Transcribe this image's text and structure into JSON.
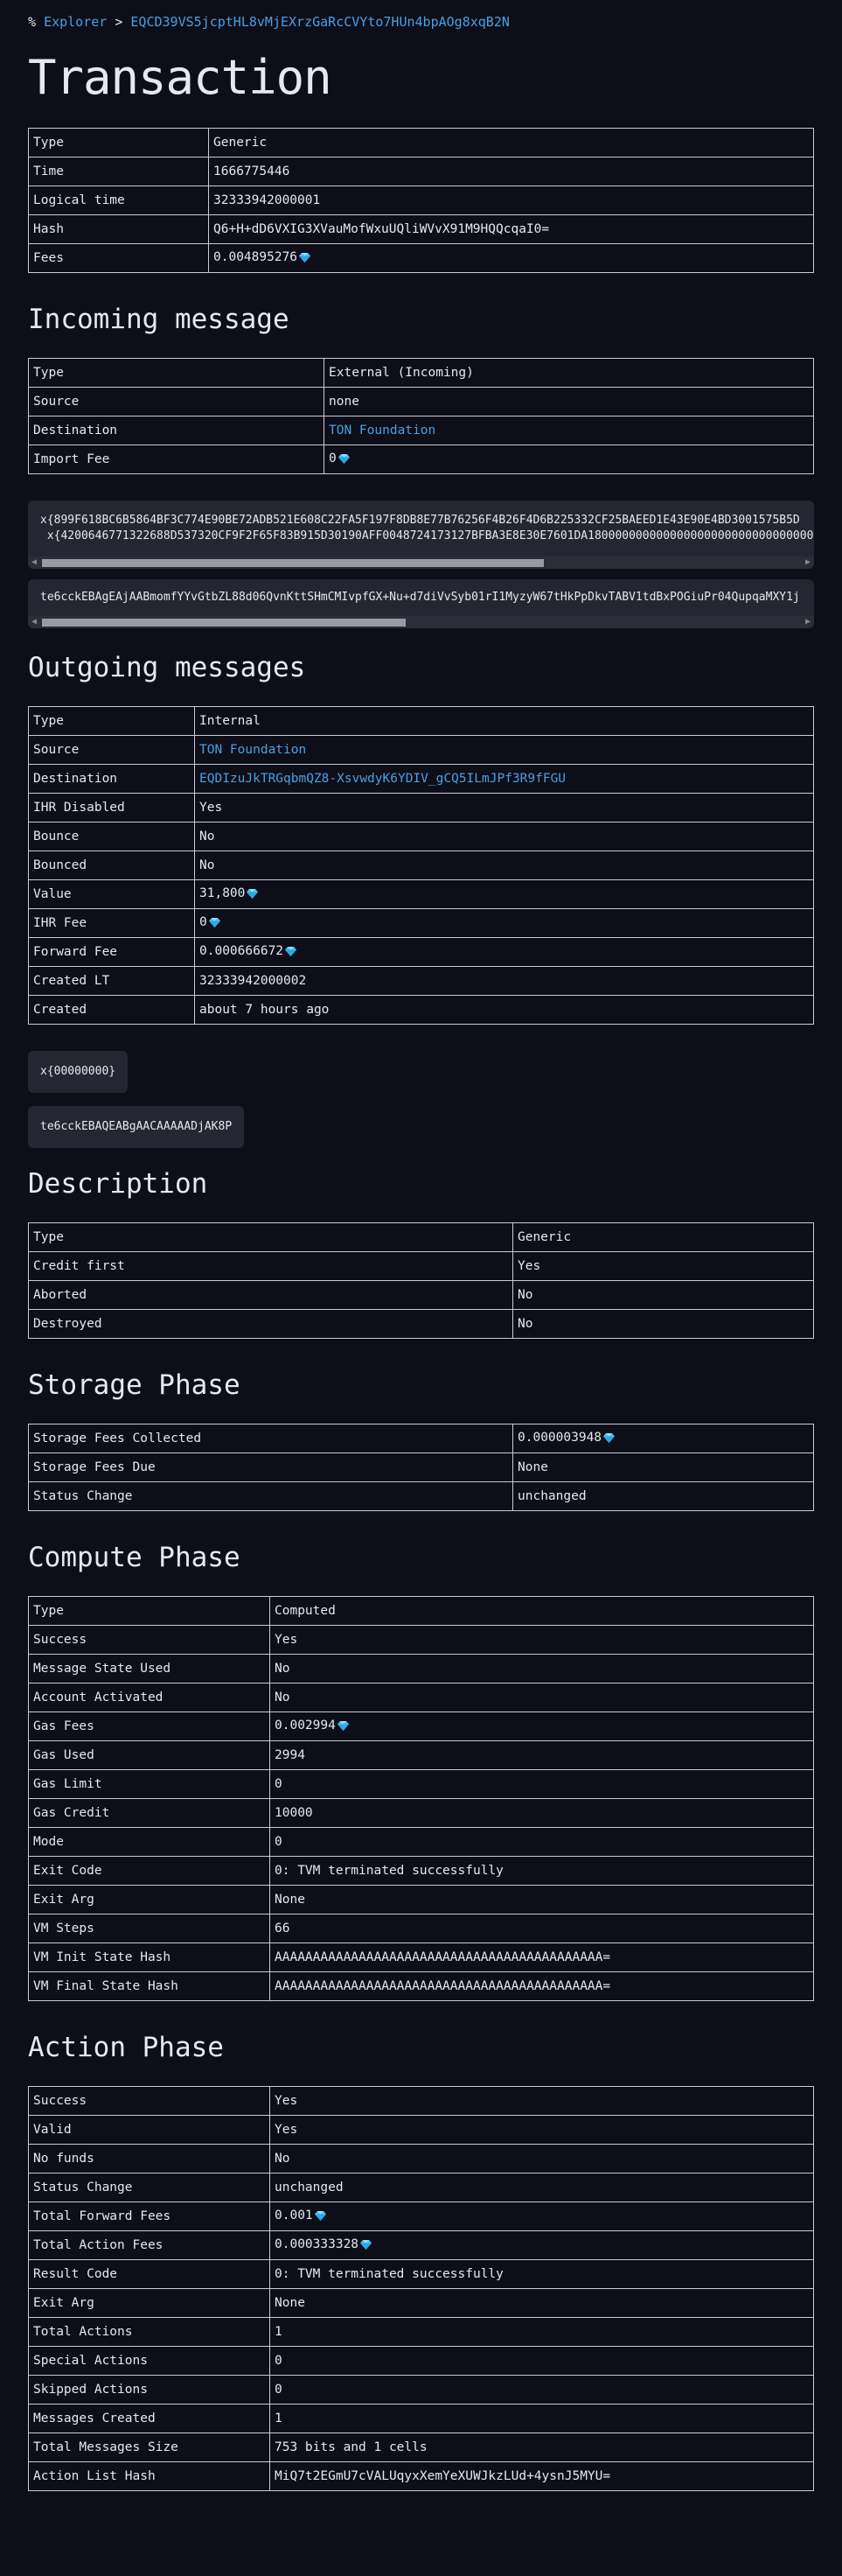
{
  "breadcrumb": {
    "icon": "%",
    "explorer": "Explorer",
    "sep": ">",
    "address": "EQCD39VS5jcptHL8vMjEXrzGaRcCVYto7HUn4bpAOg8xqB2N"
  },
  "title": "Transaction",
  "summary": [
    {
      "k": "Type",
      "v": "Generic"
    },
    {
      "k": "Time",
      "v": "1666775446"
    },
    {
      "k": "Logical time",
      "v": "32333942000001"
    },
    {
      "k": "Hash",
      "v": "Q6+H+dD6VXIG3XVauMofWxuUQliWVvX91M9HQQcqaI0="
    },
    {
      "k": "Fees",
      "v": "0.004895276",
      "gem": true
    }
  ],
  "incoming": {
    "heading": "Incoming message",
    "rows": [
      {
        "k": "Type",
        "v": "External (Incoming)"
      },
      {
        "k": "Source",
        "v": "none"
      },
      {
        "k": "Destination",
        "v": "TON Foundation",
        "link": true
      },
      {
        "k": "Import Fee",
        "v": "0",
        "gem": true
      }
    ],
    "body_line1": "x{899F618BC6B5864BF3C774E90BE72ADB521E608C22FA5F197F8DB8E77B76256F4B26F4D6B225332CF25BAEED1E43E90E4BD3001575B5D",
    "body_line2": " x{4200646771322688D537320CF9F2F65F83B915D30190AFF0048724173127BFBA3E8E30E7601DA180000000000000000000000000000000",
    "boc": "te6cckEBAgEAjAABmomfYYvGtbZL88d06QvnKttSHmCMIvpfGX+Nu+d7diVvSyb01rI1MyzyW67tHkPpDkvTABV1tdBxPOGiuPr04QupqaMXY1j"
  },
  "outgoing": {
    "heading": "Outgoing messages",
    "rows": [
      {
        "k": "Type",
        "v": "Internal"
      },
      {
        "k": "Source",
        "v": "TON Foundation",
        "link": true
      },
      {
        "k": "Destination",
        "v": "EQDIzuJkTRGqbmQZ8-XsvwdyK6YDIV_gCQ5ILmJPf3R9fFGU",
        "link": true
      },
      {
        "k": "IHR Disabled",
        "v": "Yes"
      },
      {
        "k": "Bounce",
        "v": "No"
      },
      {
        "k": "Bounced",
        "v": "No"
      },
      {
        "k": "Value",
        "v": "31,800",
        "gem": true
      },
      {
        "k": "IHR Fee",
        "v": "0",
        "gem": true
      },
      {
        "k": "Forward Fee",
        "v": "0.000666672",
        "gem": true
      },
      {
        "k": "Created LT",
        "v": "32333942000002"
      },
      {
        "k": "Created",
        "v": "about 7 hours ago"
      }
    ],
    "body": "x{00000000}",
    "boc": "te6cckEBAQEABgAACAAAAADjAK8P"
  },
  "description": {
    "heading": "Description",
    "rows": [
      {
        "k": "Type",
        "v": "Generic"
      },
      {
        "k": "Credit first",
        "v": "Yes"
      },
      {
        "k": "Aborted",
        "v": "No"
      },
      {
        "k": "Destroyed",
        "v": "No"
      }
    ]
  },
  "storage": {
    "heading": "Storage Phase",
    "rows": [
      {
        "k": "Storage Fees Collected",
        "v": "0.000003948",
        "gem": true
      },
      {
        "k": "Storage Fees Due",
        "v": "None"
      },
      {
        "k": "Status Change",
        "v": "unchanged"
      }
    ]
  },
  "compute": {
    "heading": "Compute Phase",
    "rows": [
      {
        "k": "Type",
        "v": "Computed"
      },
      {
        "k": "Success",
        "v": "Yes"
      },
      {
        "k": "Message State Used",
        "v": "No"
      },
      {
        "k": "Account Activated",
        "v": "No"
      },
      {
        "k": "Gas Fees",
        "v": "0.002994",
        "gem": true
      },
      {
        "k": "Gas Used",
        "v": "2994"
      },
      {
        "k": "Gas Limit",
        "v": "0"
      },
      {
        "k": "Gas Credit",
        "v": "10000"
      },
      {
        "k": "Mode",
        "v": "0"
      },
      {
        "k": "Exit Code",
        "v": "0: TVM terminated successfully"
      },
      {
        "k": "Exit Arg",
        "v": "None"
      },
      {
        "k": "VM Steps",
        "v": "66"
      },
      {
        "k": "VM Init State Hash",
        "v": "AAAAAAAAAAAAAAAAAAAAAAAAAAAAAAAAAAAAAAAAAAA="
      },
      {
        "k": "VM Final State Hash",
        "v": "AAAAAAAAAAAAAAAAAAAAAAAAAAAAAAAAAAAAAAAAAAA="
      }
    ]
  },
  "action": {
    "heading": "Action Phase",
    "rows": [
      {
        "k": "Success",
        "v": "Yes"
      },
      {
        "k": "Valid",
        "v": "Yes"
      },
      {
        "k": "No funds",
        "v": "No"
      },
      {
        "k": "Status Change",
        "v": "unchanged"
      },
      {
        "k": "Total Forward Fees",
        "v": "0.001",
        "gem": true
      },
      {
        "k": "Total Action Fees",
        "v": "0.000333328",
        "gem": true
      },
      {
        "k": "Result Code",
        "v": "0: TVM terminated successfully"
      },
      {
        "k": "Exit Arg",
        "v": "None"
      },
      {
        "k": "Total Actions",
        "v": "1"
      },
      {
        "k": "Special Actions",
        "v": "0"
      },
      {
        "k": "Skipped Actions",
        "v": "0"
      },
      {
        "k": "Messages Created",
        "v": "1"
      },
      {
        "k": "Total Messages Size",
        "v": "753 bits and 1 cells"
      },
      {
        "k": "Action List Hash",
        "v": "MiQ7t2EGmU7cVALUqyxXemYeXUWJkzLUd+4ysnJ5MYU="
      }
    ]
  },
  "colors": {
    "bg": "#0d0e17",
    "link": "#4a9fe6",
    "gem": "#4fc3f7",
    "codebox": "#252631"
  }
}
